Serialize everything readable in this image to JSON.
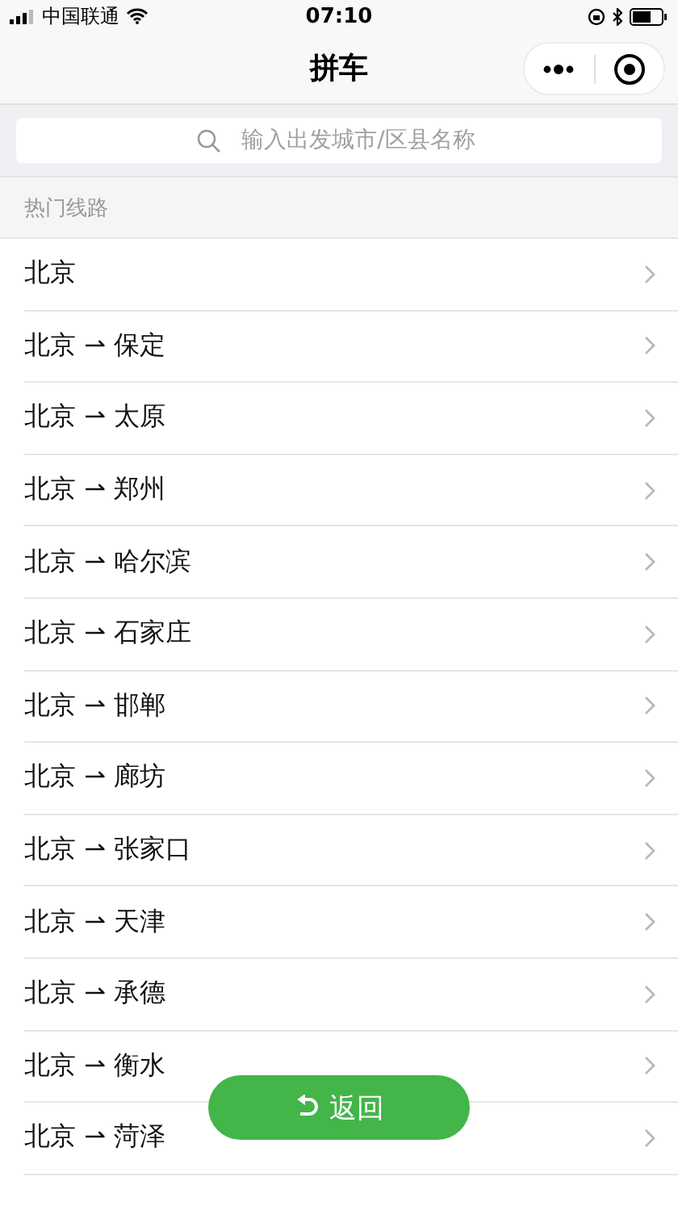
{
  "status_bar": {
    "carrier": "中国联通",
    "time": "07:10"
  },
  "nav_bar": {
    "title": "拼车"
  },
  "search": {
    "placeholder": "输入出发城市/区县名称"
  },
  "section": {
    "title": "热门线路"
  },
  "routes": [
    {
      "label": "北京"
    },
    {
      "label": "北京 ⇀ 保定"
    },
    {
      "label": "北京 ⇀ 太原"
    },
    {
      "label": "北京 ⇀ 郑州"
    },
    {
      "label": "北京 ⇀ 哈尔滨"
    },
    {
      "label": "北京 ⇀ 石家庄"
    },
    {
      "label": "北京 ⇀ 邯郸"
    },
    {
      "label": "北京 ⇀ 廊坊"
    },
    {
      "label": "北京 ⇀ 张家口"
    },
    {
      "label": "北京 ⇀ 天津"
    },
    {
      "label": "北京 ⇀ 承德"
    },
    {
      "label": "北京 ⇀ 衡水"
    },
    {
      "label": "北京 ⇀ 菏泽"
    }
  ],
  "back_button": {
    "label": "返回"
  }
}
